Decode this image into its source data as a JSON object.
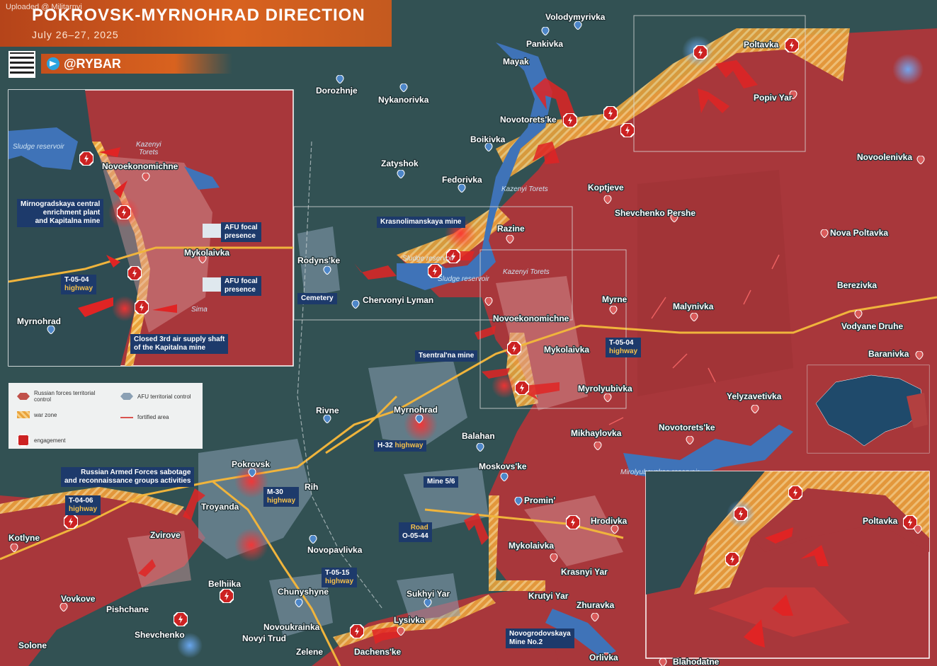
{
  "watermark": "Uploaded @ Militarnyi",
  "header": {
    "title": "POKROVSK-MYRNOHRAD DIRECTION",
    "date": "July 26–27, 2025"
  },
  "brand": {
    "handle": "@RYBAR",
    "icon": "telegram-icon",
    "qr": "qr-code"
  },
  "colors": {
    "russian_control": "#a8373b",
    "afu_control": "#2f4c52",
    "war_zone": "#e9a23b",
    "engagement": "#cc2222",
    "highway": "#f0b43c",
    "water": "#3f73b8"
  },
  "legend": {
    "russian": "Russian forces territorial control",
    "afu": "AFU territorial control",
    "war_zone": "war zone",
    "fortified": "fortified area",
    "engagement": "engagement"
  },
  "towns": {
    "volodymyrivka": "Volodymyrivka",
    "pankivka": "Pankivka",
    "poltavka": "Poltavka",
    "mayak": "Mayak",
    "dorozhnje": "Dorozhnje",
    "nykanorivka": "Nykanorivka",
    "popiv_yar": "Popiv Yar",
    "novotoretske_n": "Novotorets'ke",
    "boikivka": "Boikivka",
    "zatyshok": "Zatyshok",
    "fedorivka": "Fedorivka",
    "novoolenivka": "Novoolenivka",
    "koptjeve": "Koptjeve",
    "shevchenko_pershe": "Shevchenko Pershe",
    "razine": "Razine",
    "nova_poltavka": "Nova Poltavka",
    "rodynske": "Rodyns'ke",
    "chervonyi_lyman": "Chervonyi Lyman",
    "novoekonomichne": "Novoekonomichne",
    "myrne": "Myrne",
    "malynivka": "Malynivka",
    "berezivka": "Berezivka",
    "vodyane_druhe": "Vodyane Druhe",
    "mykolaivka": "Mykolaivka",
    "baranivka": "Baranivka",
    "myrolyubivka": "Myrolyubivka",
    "yelyzavetivka": "Yelyzavetivka",
    "rivne": "Rivne",
    "myrnohrad": "Myrnohrad",
    "balahan": "Balahan",
    "mikhaylovka": "Mikhaylovka",
    "novotoretske_s": "Novotorets'ke",
    "moskovske": "Moskovs'ke",
    "pokrovsk": "Pokrovsk",
    "rih": "Rih",
    "promin": "Promin'",
    "troyanda": "Troyanda",
    "kotlyne": "Kotlyne",
    "zvirove": "Zvirove",
    "novopavlivka": "Novopavlivka",
    "hrodivka": "Hrodivka",
    "mykolaivka_s": "Mykolaivka",
    "krasnyi_yar": "Krasnyi Yar",
    "belhiika": "Belhiika",
    "chunyshyne": "Chunyshyne",
    "sukhyi_yar": "Sukhyi Yar",
    "krutyi_yar": "Krutyi Yar",
    "vovkove": "Vovkove",
    "pishchane": "Pishchane",
    "zhuravka": "Zhuravka",
    "lysivka": "Lysivka",
    "shevchenko": "Shevchenko",
    "novoukrainka": "Novoukrainka",
    "solone": "Solone",
    "novyi_trud": "Novyi Trud",
    "zelene": "Zelene",
    "dachenske": "Dachens'ke",
    "orlivka": "Orlivka",
    "blahodatne": "Blahodatne"
  },
  "water_labels": {
    "kazenyi_torets_1": "Kazenyi Torets",
    "kazenyi_torets_2": "Kazenyi Torets",
    "sludge_1": "Sludge reservoir",
    "sludge_2": "Sludge reservoir",
    "myrolubovskoe": "Mirolyubovskoe reservoir"
  },
  "callouts": {
    "krasnolimanskaya": "Krasnolimanskaya mine",
    "cemetery": "Cemetery",
    "tsentralna": "Tsentral'na mine",
    "t0504_road": "T-05-04",
    "t0504_hw": "highway",
    "h32_road": "H-32",
    "h32_hw": "highway",
    "m30_road": "M-30",
    "m30_hw": "highway",
    "mine56": "Mine 5/6",
    "o0544_road": "Road",
    "o0544_num": "O-05-44",
    "t0406_road": "T-04-06",
    "t0406_hw": "highway",
    "t0515_road": "T-05-15",
    "t0515_hw": "highway",
    "sabotage_1": "Russian Armed Forces sabotage",
    "sabotage_2": "and reconnaissance groups activities",
    "novogrodovskaya_1": "Novogrodovskaya",
    "novogrodovskaya_2": "Mine No.2"
  },
  "inset_left": {
    "sludge": "Sludge reservoir",
    "kazenyi": "Kazenyi",
    "torets": "Torets",
    "novoekonomichne": "Novoekonomichne",
    "plant_1": "Mirnogradskaya central",
    "plant_2": "enrichment plant",
    "plant_3": "and Kapitalna mine",
    "afu_1a": "AFU focal",
    "afu_1b": "presence",
    "afu_2a": "AFU focal",
    "afu_2b": "presence",
    "mykolaivka": "Mykolaivka",
    "t0504": "T-05-04",
    "t0504_hw": "highway",
    "myrnohrad": "Myrnohrad",
    "shaft_1": "Closed 3rd air supply shaft",
    "shaft_2": "of the Kapitalna mine",
    "simvol": "Sima"
  },
  "inset_right": {
    "poltavka": "Poltavka"
  }
}
